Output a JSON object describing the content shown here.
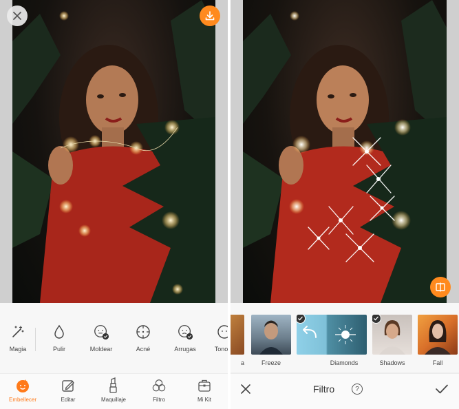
{
  "left": {
    "close_icon": "close-icon",
    "download_icon": "download-icon",
    "tools": [
      {
        "label": "Magia",
        "icon": "magic-wand-icon"
      },
      {
        "label": "Pulir",
        "icon": "drop-icon"
      },
      {
        "label": "Moldear",
        "icon": "face-reshape-icon"
      },
      {
        "label": "Acné",
        "icon": "acne-target-icon"
      },
      {
        "label": "Arrugas",
        "icon": "wrinkle-face-icon"
      },
      {
        "label": "Tono D",
        "icon": "skin-tone-icon"
      }
    ],
    "nav": [
      {
        "label": "Embellecer",
        "icon": "beautify-face-icon",
        "active": true
      },
      {
        "label": "Editar",
        "icon": "edit-pencil-icon",
        "active": false
      },
      {
        "label": "Maquillaje",
        "icon": "lipstick-icon",
        "active": false
      },
      {
        "label": "Filtro",
        "icon": "filter-circles-icon",
        "active": false
      },
      {
        "label": "Mi Kit",
        "icon": "kit-box-icon",
        "active": false
      }
    ]
  },
  "right": {
    "compare_icon": "compare-split-icon",
    "filters": [
      {
        "label": "a",
        "selected": false
      },
      {
        "label": "Freeze",
        "selected": false
      },
      {
        "label": "Diamonds",
        "selected": true
      },
      {
        "label": "Shadows",
        "selected": false
      },
      {
        "label": "Fall",
        "selected": false
      }
    ],
    "filter_bar": {
      "title": "Filtro",
      "help_label": "?"
    }
  },
  "colors": {
    "accent": "#ff8a1e",
    "active_text": "#ff7a1a",
    "sweater": "#a8261b"
  }
}
